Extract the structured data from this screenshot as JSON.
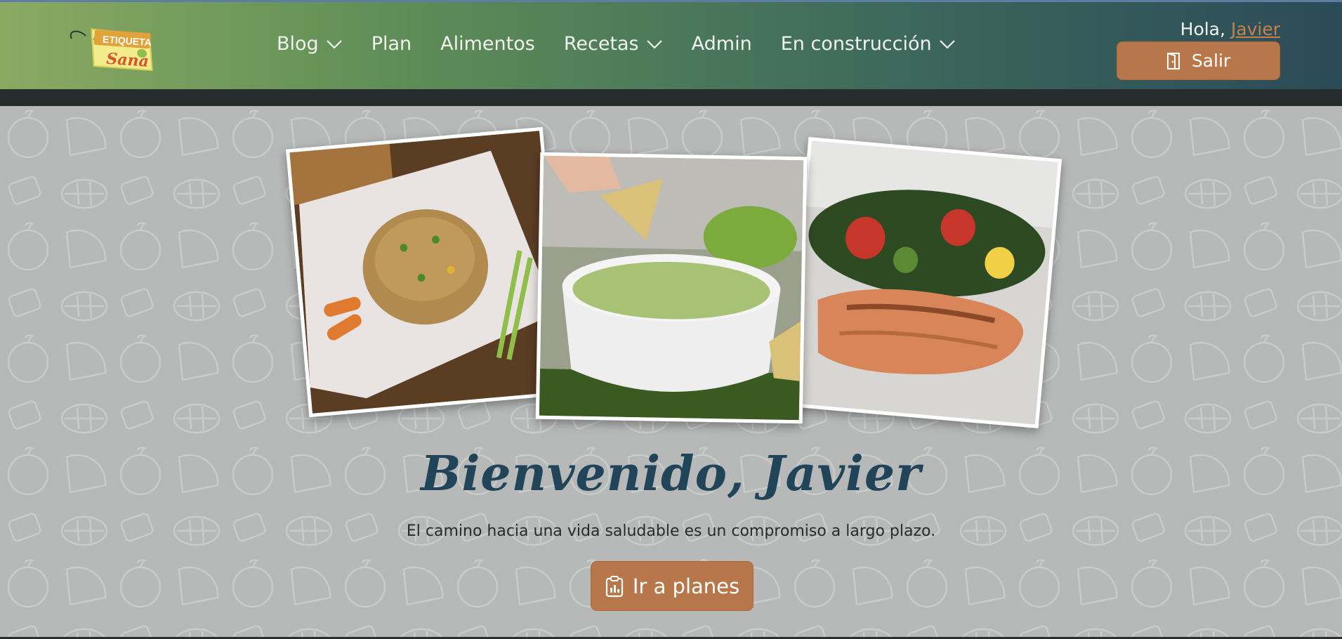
{
  "logo": {
    "line1": "ETIQUETA",
    "line2": "Sana"
  },
  "nav": {
    "items": [
      {
        "label": "Blog",
        "dropdown": true
      },
      {
        "label": "Plan",
        "dropdown": false
      },
      {
        "label": "Alimentos",
        "dropdown": false
      },
      {
        "label": "Recetas",
        "dropdown": true
      },
      {
        "label": "Admin",
        "dropdown": false
      },
      {
        "label": "En construcción",
        "dropdown": true
      }
    ]
  },
  "user": {
    "greeting": "Hola,",
    "name": "Javier"
  },
  "buttons": {
    "logout": "Salir",
    "plans": "Ir a planes"
  },
  "hero": {
    "title": "Bienvenido, Javier",
    "subtitle": "El camino hacia una vida saludable es un compromiso a largo plazo."
  },
  "colors": {
    "accent": "#b8774a",
    "title": "#224459",
    "background": "#b7b9b9",
    "nav_start": "#8aaa62",
    "nav_end": "#2b4a58"
  },
  "icons": {
    "logout": "door-icon",
    "plans": "clipboard-chart-icon",
    "dropdown": "chevron-down-icon"
  }
}
